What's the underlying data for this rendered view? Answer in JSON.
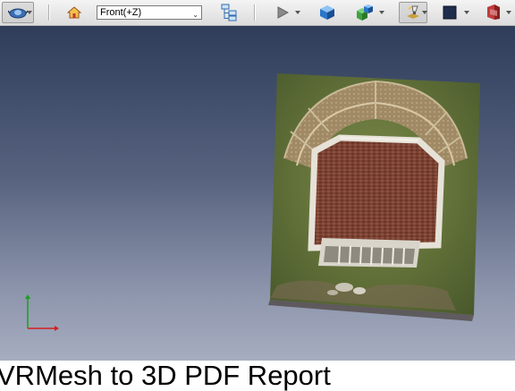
{
  "toolbar": {
    "view_select": {
      "value": "Front(+Z)",
      "arrow": "⌄"
    },
    "icons": [
      "camera-navigation-icon",
      "home-view-icon",
      "model-tree-icon",
      "play-animation-icon",
      "3d-cube-icon",
      "lighting-cubes-icon",
      "render-mode-icon",
      "background-color-icon",
      "cross-section-icon"
    ]
  },
  "caption": {
    "text": "VRMesh to 3D PDF Report"
  },
  "colors": {
    "viewport_top": "#2f3d5a",
    "viewport_bottom": "#a6adc0",
    "axis_x": "#d22020",
    "axis_y": "#1aa01a"
  }
}
